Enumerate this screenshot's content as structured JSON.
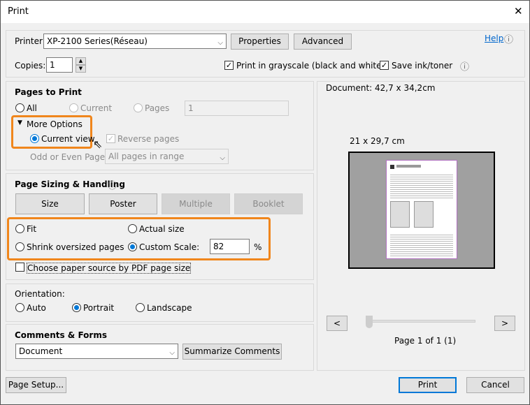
{
  "window": {
    "title": "Print",
    "close": "✕"
  },
  "printer": {
    "label": "Printer:",
    "value": "XP-2100 Series(Réseau)",
    "properties": "Properties",
    "advanced": "Advanced",
    "help": "Help"
  },
  "copies": {
    "label": "Copies:",
    "value": "1"
  },
  "options": {
    "grayscale": "Print in grayscale (black and white)",
    "grayscale_checked": true,
    "save_ink": "Save ink/toner",
    "save_ink_checked": true
  },
  "pages": {
    "heading": "Pages to Print",
    "all": "All",
    "current": "Current",
    "pages": "Pages",
    "pages_value": "1",
    "more_options": "More Options",
    "current_view": "Current view",
    "reverse": "Reverse pages",
    "odd_even_label": "Odd or Even Pages:",
    "odd_even_value": "All pages in range"
  },
  "sizing": {
    "heading": "Page Sizing & Handling",
    "tabs": [
      "Size",
      "Poster",
      "Multiple",
      "Booklet"
    ],
    "fit": "Fit",
    "actual": "Actual size",
    "shrink": "Shrink oversized pages",
    "custom": "Custom Scale:",
    "scale_value": "82",
    "percent": "%",
    "paper_source": "Choose paper source by PDF page size"
  },
  "orientation": {
    "heading": "Orientation:",
    "auto": "Auto",
    "portrait": "Portrait",
    "landscape": "Landscape",
    "selected": "Portrait"
  },
  "comments": {
    "heading": "Comments & Forms",
    "value": "Document",
    "summarize": "Summarize Comments"
  },
  "preview": {
    "document_size": "Document: 42,7 x 34,2cm",
    "paper_size": "21 x 29,7 cm",
    "prev": "<",
    "next": ">",
    "page_info": "Page 1 of 1 (1)",
    "page_fraction": 0
  },
  "footer": {
    "page_setup": "Page Setup...",
    "print": "Print",
    "cancel": "Cancel"
  },
  "colors": {
    "highlight": "#f0861c",
    "accent": "#0078d7"
  }
}
